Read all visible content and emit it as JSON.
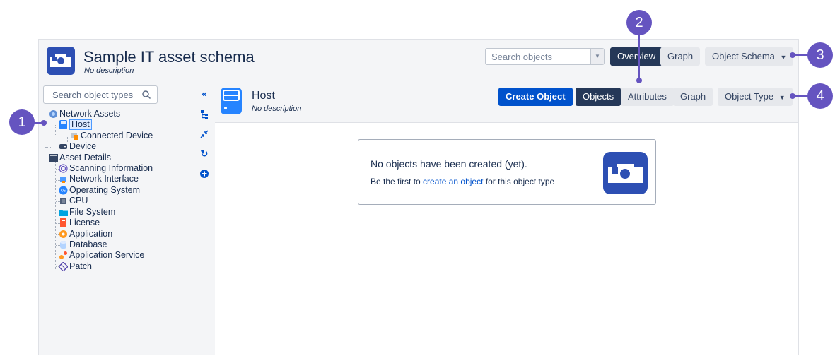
{
  "header": {
    "schema_title": "Sample IT asset schema",
    "schema_description": "No description",
    "search_placeholder": "Search objects",
    "overview_label": "Overview",
    "graph_label": "Graph",
    "schema_menu_label": "Object Schema"
  },
  "sidebar": {
    "search_placeholder": "Search object types",
    "tree": [
      {
        "label": "Network Assets",
        "icon": "globe-icon"
      },
      {
        "label": "Host",
        "icon": "server-icon",
        "selected": true
      },
      {
        "label": "Connected Device",
        "icon": "device-icon"
      },
      {
        "label": "Device",
        "icon": "hard-drive-icon"
      },
      {
        "label": "Asset Details",
        "icon": "rack-icon"
      },
      {
        "label": "Scanning Information",
        "icon": "fingerprint-icon"
      },
      {
        "label": "Network Interface",
        "icon": "network-interface-icon"
      },
      {
        "label": "Operating System",
        "icon": "os-icon"
      },
      {
        "label": "CPU",
        "icon": "cpu-icon"
      },
      {
        "label": "File System",
        "icon": "folder-icon"
      },
      {
        "label": "License",
        "icon": "license-icon"
      },
      {
        "label": "Application",
        "icon": "application-icon"
      },
      {
        "label": "Database",
        "icon": "database-icon"
      },
      {
        "label": "Application Service",
        "icon": "service-icon"
      },
      {
        "label": "Patch",
        "icon": "patch-icon"
      }
    ]
  },
  "tools": [
    "collapse-icon",
    "hierarchy-icon",
    "minimize-icon",
    "refresh-icon",
    "add-icon"
  ],
  "object_type": {
    "title": "Host",
    "description": "No description",
    "create_label": "Create Object",
    "tab_objects": "Objects",
    "tab_attributes": "Attributes",
    "tab_graph": "Graph",
    "type_menu_label": "Object Type"
  },
  "empty_state": {
    "title": "No objects have been created (yet).",
    "text_before": "Be the first to",
    "link_text": "create an object",
    "text_after": "for this object type"
  },
  "callouts": [
    "1",
    "2",
    "3",
    "4"
  ],
  "colors": {
    "callout": "#6554c0",
    "primary_button": "#0052cc",
    "dark_button": "#253858",
    "brand_blue": "#2d4fb3"
  }
}
